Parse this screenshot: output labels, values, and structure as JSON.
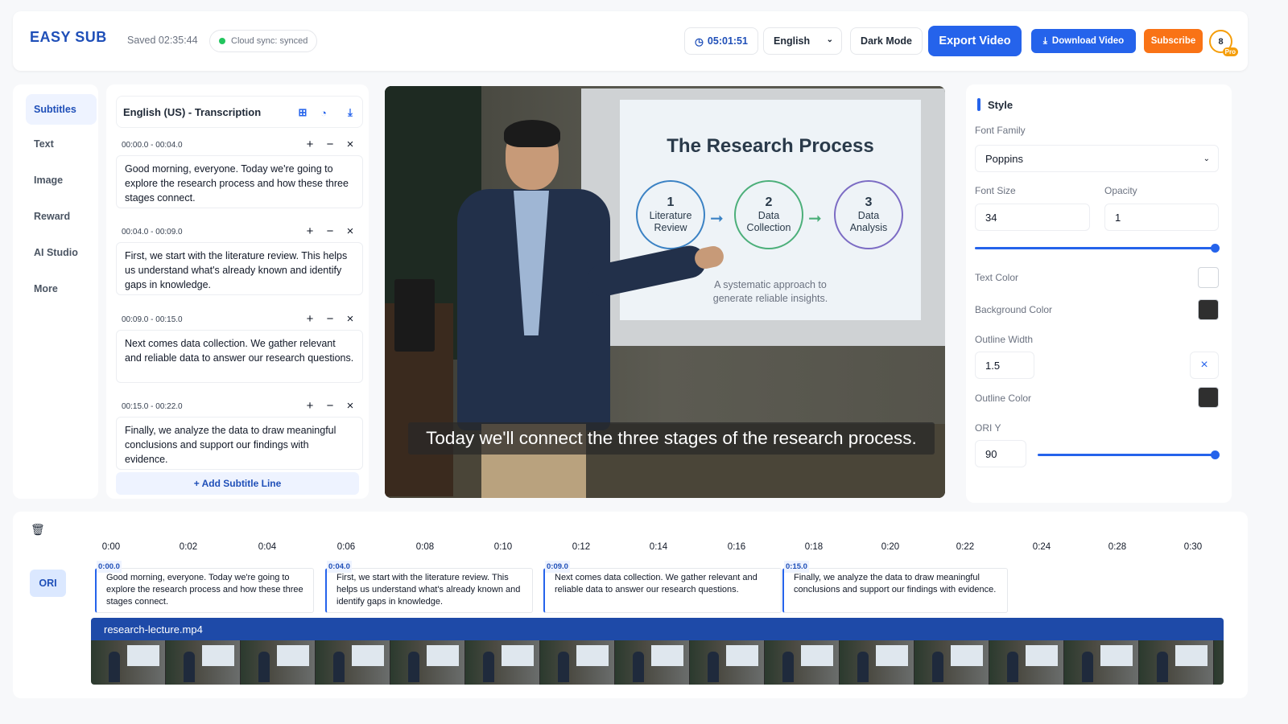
{
  "header": {
    "logo_text": "EASY SUB",
    "saved": "Saved 02:35:44",
    "sync_status": "Cloud sync: synced",
    "timer": "05:01:51",
    "language": "English",
    "dark_mode_label": "Dark Mode",
    "export_label": "Export Video",
    "download_label": "Download Video",
    "subscribe_label": "Subscribe",
    "avatar_initial": "8",
    "pro_badge": "Pro"
  },
  "sidebar": {
    "items": [
      {
        "label": "Subtitles",
        "active": true
      },
      {
        "label": "Text"
      },
      {
        "label": "Image"
      },
      {
        "label": "Reward"
      },
      {
        "label": "AI Studio"
      },
      {
        "label": "More"
      }
    ]
  },
  "transcription": {
    "title": "English (US) - Transcription",
    "icons": [
      "grid-icon",
      "palette-icon",
      "download-icon"
    ],
    "cues": [
      {
        "time": "00:00.0 - 00:04.0",
        "text": "Good morning, everyone. Today we're going to explore the research process and how these three stages connect."
      },
      {
        "time": "00:04.0 - 00:09.0",
        "text": "First, we start with the literature review. This helps us understand what's already known and identify gaps in knowledge."
      },
      {
        "time": "00:09.0 - 00:15.0",
        "text": "Next comes data collection. We gather relevant and reliable data to answer our research questions."
      },
      {
        "time": "00:15.0 - 00:22.0",
        "text": "Finally, we analyze the data to draw meaningful conclusions and support our findings with evidence."
      }
    ],
    "add_line_label": "+ Add Subtitle Line"
  },
  "video": {
    "slide_title": "The Research Process",
    "stages": [
      {
        "num": "1",
        "l1": "Literature",
        "l2": "Review",
        "color": "#3b82c4"
      },
      {
        "num": "2",
        "l1": "Data",
        "l2": "Collection",
        "color": "#4caf7a"
      },
      {
        "num": "3",
        "l1": "Data",
        "l2": "Analysis",
        "color": "#7c6cc4"
      }
    ],
    "slide_sub_1": "A systematic approach to",
    "slide_sub_2": "generate reliable insights.",
    "caption": "Today we'll connect the three stages of the research process."
  },
  "style_panel": {
    "title": "Style",
    "font_family_label": "Font Family",
    "font_family": "Poppins",
    "font_size_label": "Font Size",
    "font_size": "34",
    "opacity_label": "Opacity",
    "opacity": "1",
    "opacity_level": 1.0,
    "text_color_label": "Text Color",
    "text_color": "#ffffff",
    "bg_color_label": "Background Color",
    "bg_color": "#2f2f2f",
    "outline_width_label": "Outline Width",
    "outline_width": "1.5",
    "outline_color_label": "Outline Color",
    "outline_color": "#2f2f2f",
    "ori_y_label": "ORI Y",
    "ori_y": "90",
    "ori_y_level": 1.0
  },
  "timeline": {
    "ticks": [
      "0:00",
      "0:02",
      "0:04",
      "0:06",
      "0:08",
      "0:10",
      "0:12",
      "0:14",
      "0:16",
      "0:18",
      "0:20",
      "0:22",
      "0:24",
      "0:28",
      "0:30"
    ],
    "track_label": "ORI",
    "segments": [
      {
        "start": "0:00.0",
        "text": "Good morning, everyone. Today we're going to explore the research process and how these three stages connect."
      },
      {
        "start": "0:04.0",
        "text": "First, we start with the literature review. This helps us understand what's already known and identify gaps in knowledge."
      },
      {
        "start": "0:09.0",
        "text": "Next comes data collection. We gather relevant and reliable data to answer our research questions."
      },
      {
        "start": "0:15.0",
        "text": "Finally, we analyze the data to draw meaningful conclusions and support our findings with evidence."
      }
    ],
    "video_file": "research-lecture.mp4"
  },
  "colors": {
    "accent": "#2563eb",
    "brand": "#1f4fb8",
    "subscribe": "#f97316"
  }
}
